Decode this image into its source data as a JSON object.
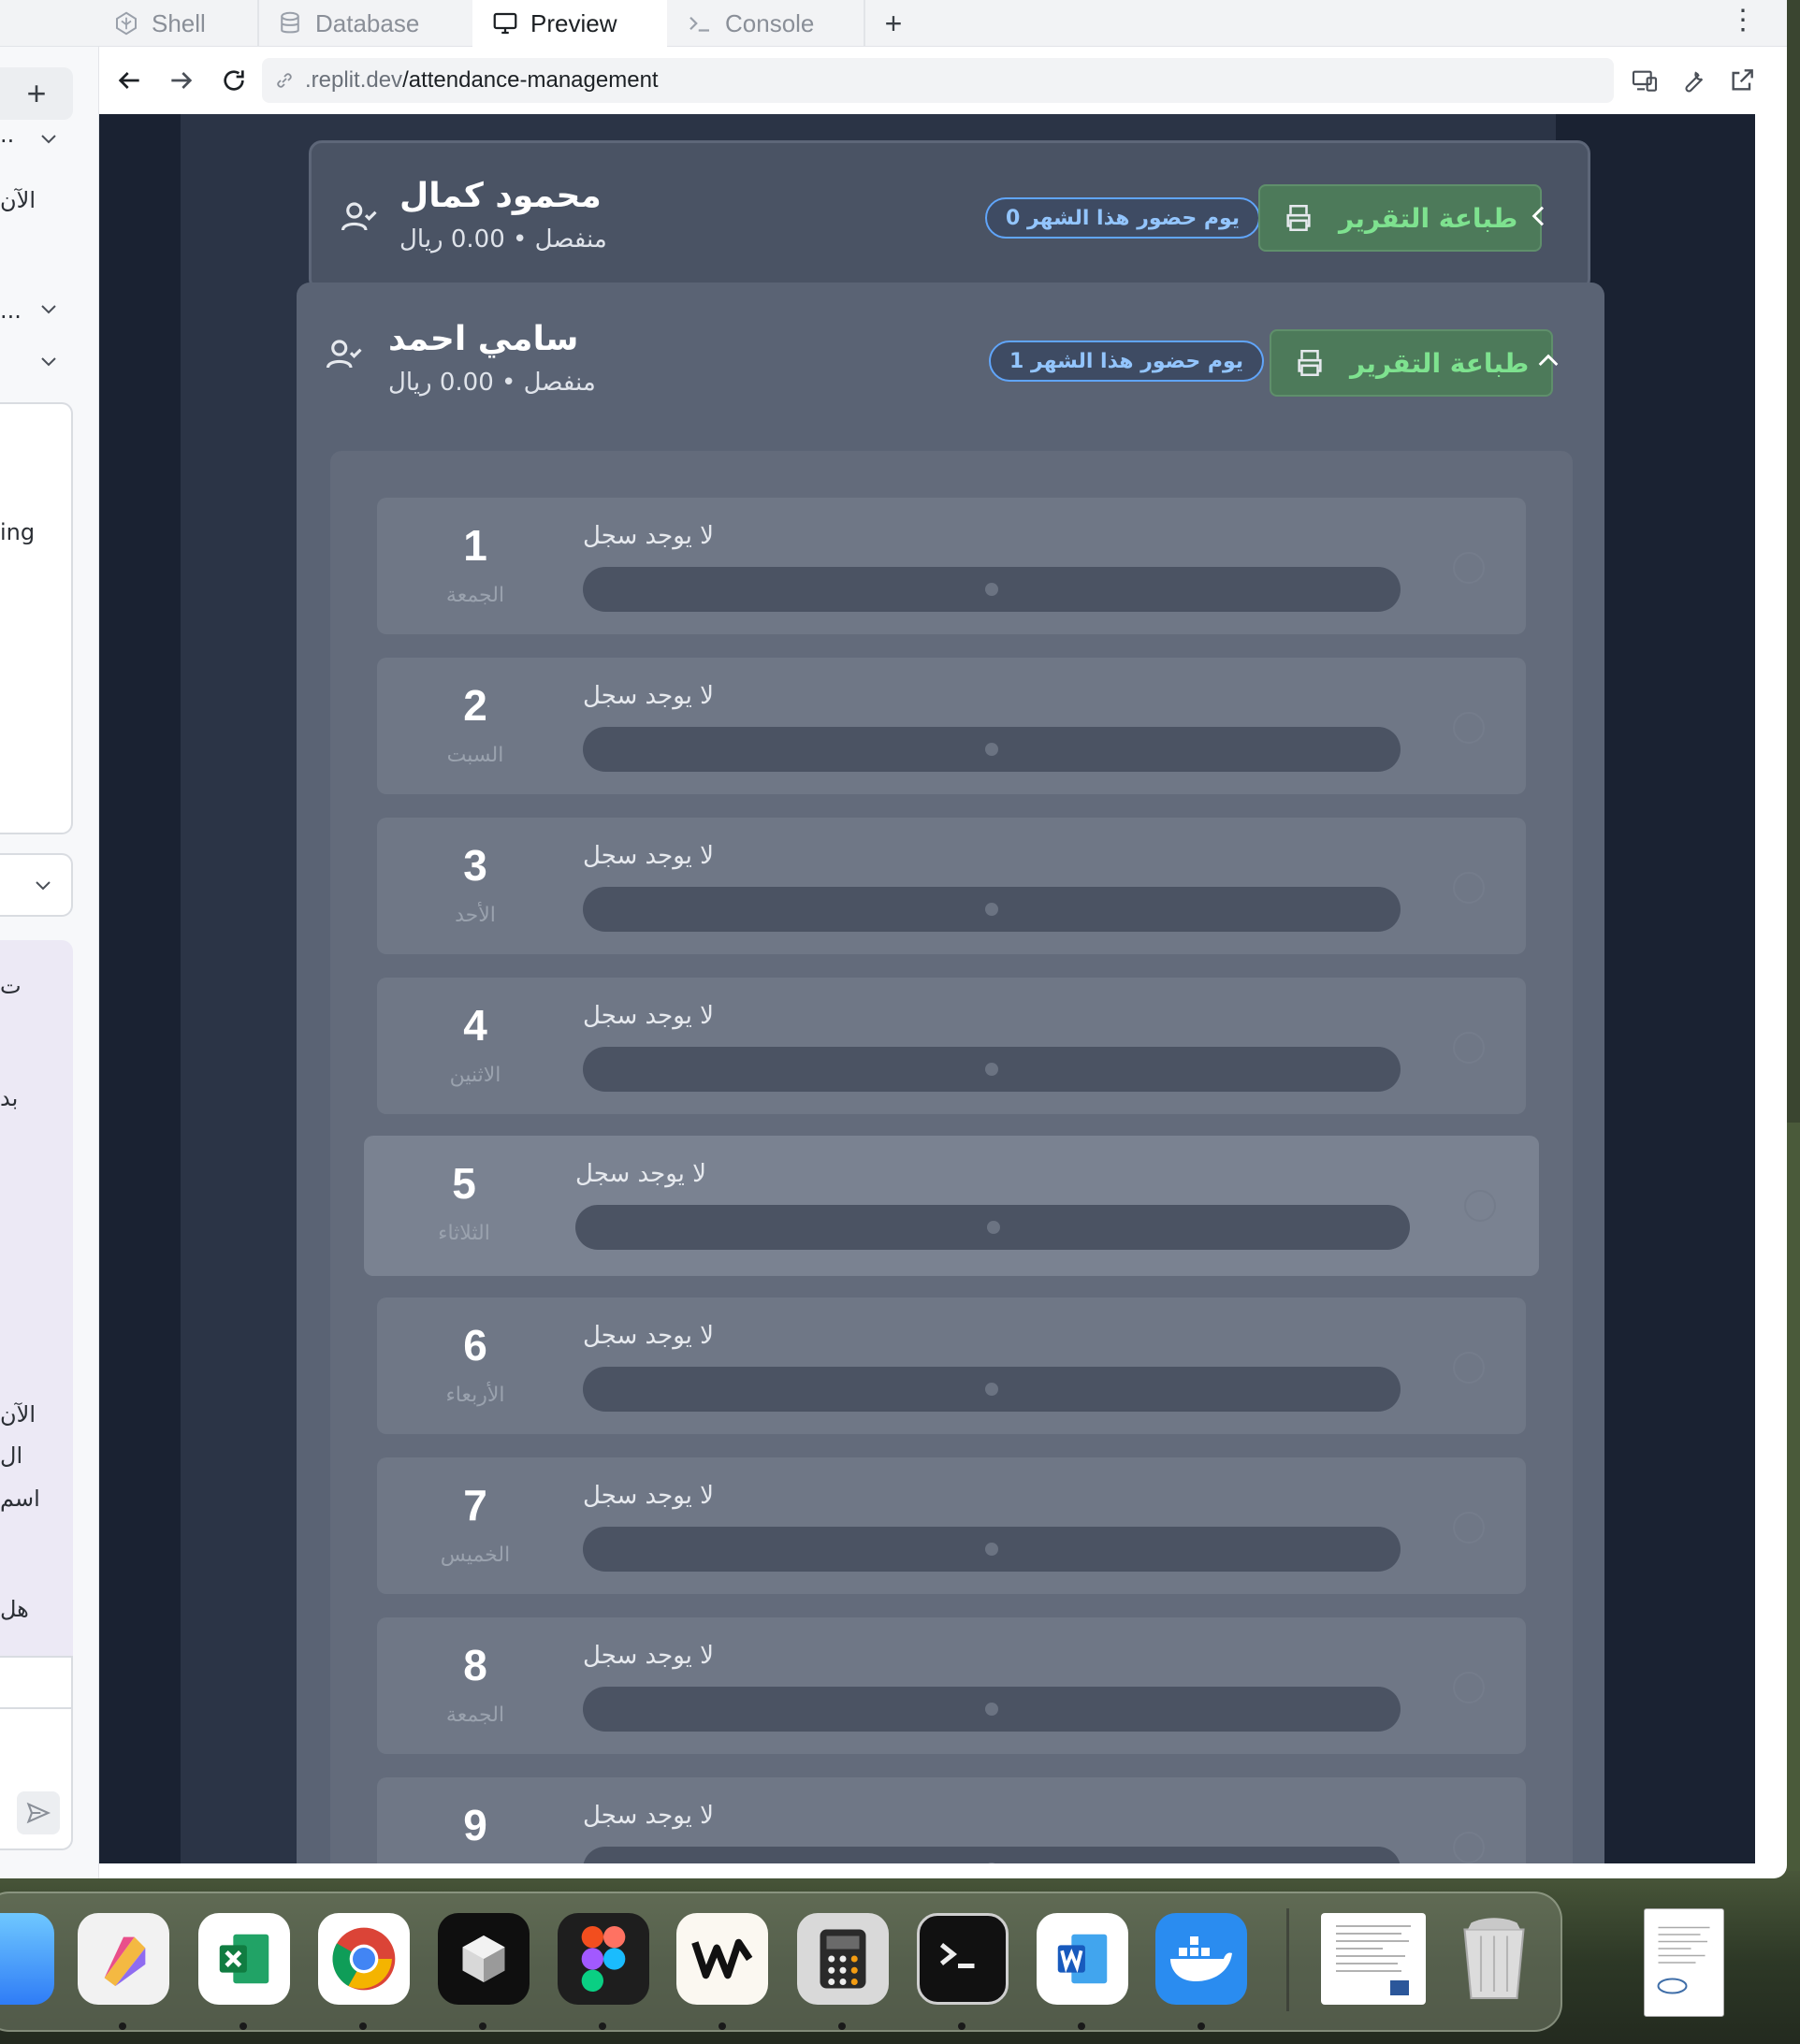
{
  "tabs": [
    {
      "label": "Shell",
      "icon": "shell-icon"
    },
    {
      "label": "Database",
      "icon": "database-icon"
    },
    {
      "label": "Preview",
      "icon": "monitor-icon",
      "active": true
    },
    {
      "label": "Console",
      "icon": "console-icon"
    }
  ],
  "url": {
    "domain": ".replit.dev",
    "path": "/attendance-management"
  },
  "sidebar": {
    "snippets": [
      "..",
      "الآن",
      "...",
      "ing",
      "ت",
      "بد",
      "الآن",
      "ال",
      "اسم",
      "هل"
    ]
  },
  "employees": [
    {
      "name": "محمود كمال",
      "subtitle": "منفصل • 0.00 ريال",
      "badge": "يوم حضور هذا الشهر 0",
      "print_label": "طباعة التقرير",
      "expanded": false
    },
    {
      "name": "سامي احمد",
      "subtitle": "منفصل • 0.00 ريال",
      "badge": "يوم حضور هذا الشهر 1",
      "print_label": "طباعة التقرير",
      "expanded": true,
      "days": [
        {
          "num": "1",
          "name": "الجمعة",
          "status": "لا يوجد سجل"
        },
        {
          "num": "2",
          "name": "السبت",
          "status": "لا يوجد سجل"
        },
        {
          "num": "3",
          "name": "الأحد",
          "status": "لا يوجد سجل"
        },
        {
          "num": "4",
          "name": "الاثنين",
          "status": "لا يوجد سجل"
        },
        {
          "num": "5",
          "name": "الثلاثاء",
          "status": "لا يوجد سجل"
        },
        {
          "num": "6",
          "name": "الأربعاء",
          "status": "لا يوجد سجل"
        },
        {
          "num": "7",
          "name": "الخميس",
          "status": "لا يوجد سجل"
        },
        {
          "num": "8",
          "name": "الجمعة",
          "status": "لا يوجد سجل"
        },
        {
          "num": "9",
          "name": "",
          "status": "لا يوجد سجل"
        }
      ]
    }
  ],
  "dock": [
    "finder-icon",
    "pages-icon",
    "excel-icon",
    "chrome-icon",
    "cube-app-icon",
    "figma-icon",
    "notion-w-icon",
    "calculator-icon",
    "terminal-icon",
    "word-icon",
    "docker-icon",
    "document-thumbnail-icon",
    "trash-icon",
    "document-thumbnail-icon"
  ],
  "colors": {
    "accent_green": "#7ee28f",
    "badge_blue": "#60a5fa",
    "preview_bg": "#1a2232"
  }
}
